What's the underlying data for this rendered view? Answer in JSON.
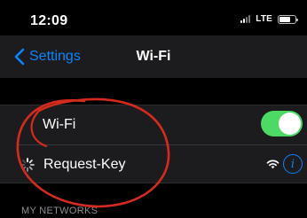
{
  "status_bar": {
    "time": "12:09",
    "network": "LTE",
    "signal_bars_on": 2,
    "signal_bars_total": 4,
    "battery_level": 0.7
  },
  "nav": {
    "back_label": "Settings",
    "title": "Wi-Fi"
  },
  "wifi_toggle": {
    "label": "Wi-Fi",
    "enabled": true
  },
  "current_network": {
    "name": "Request-Key",
    "status": "connecting",
    "info_glyph": "i"
  },
  "section_header": "MY NETWORKS",
  "colors": {
    "accent": "#0a84ff",
    "toggle_on": "#4cd964",
    "annotation": "#d52b1e",
    "cell_bg": "#1c1c1e"
  },
  "icons": {
    "back": "chevron-left-icon",
    "spinner": "loading-spinner-icon",
    "wifi": "wifi-signal-icon",
    "info": "info-icon",
    "signal": "cellular-signal-icon",
    "battery": "battery-icon"
  }
}
